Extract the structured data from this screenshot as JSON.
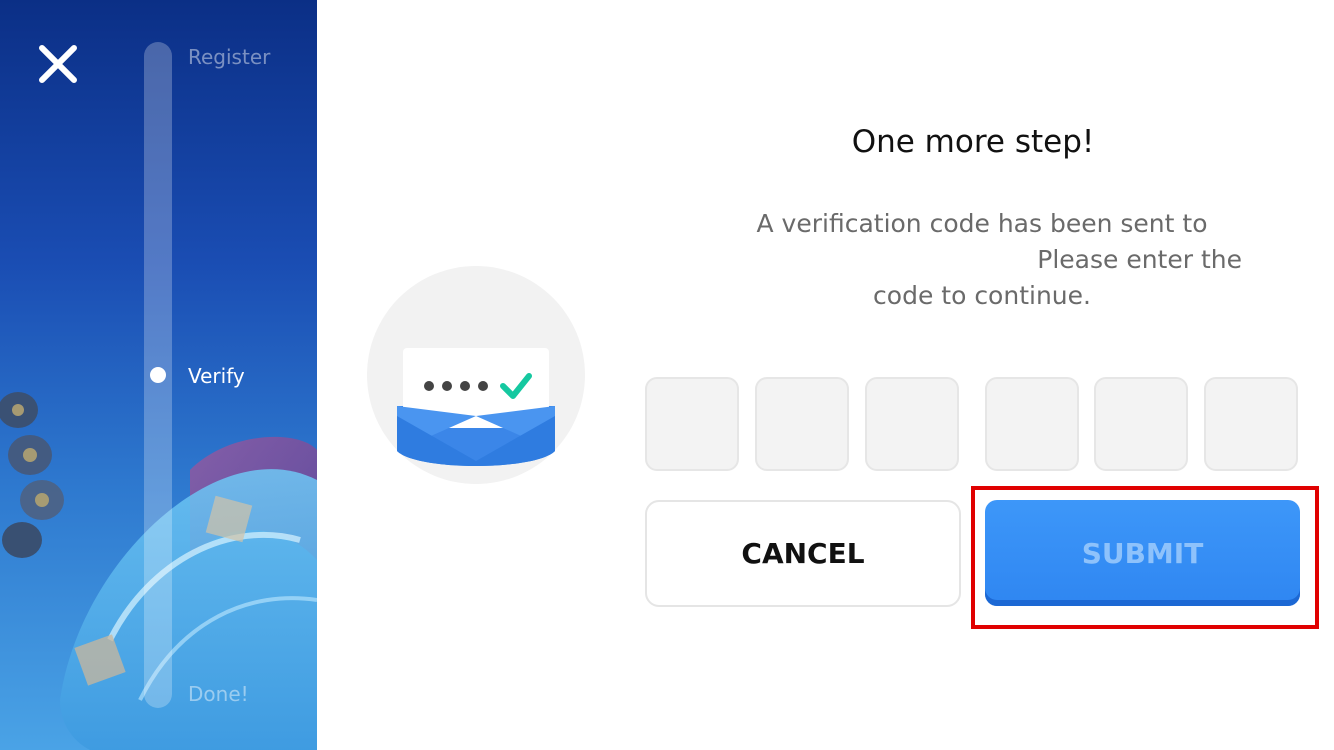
{
  "steps": {
    "register": "Register",
    "verify": "Verify",
    "done": "Done!"
  },
  "content": {
    "title": "One more step!",
    "description_line1": "A verification code has been sent to",
    "description_line2": "Please enter the",
    "description_line3": "code to continue."
  },
  "code_inputs": [
    "",
    "",
    "",
    "",
    "",
    ""
  ],
  "buttons": {
    "cancel": "CANCEL",
    "submit": "SUBMIT"
  },
  "icons": {
    "close": "close-icon",
    "illustration": "envelope-verification-icon"
  },
  "colors": {
    "accent_blue": "#2f86f1",
    "highlight_red": "#e00000",
    "check_green": "#15c8a0"
  }
}
